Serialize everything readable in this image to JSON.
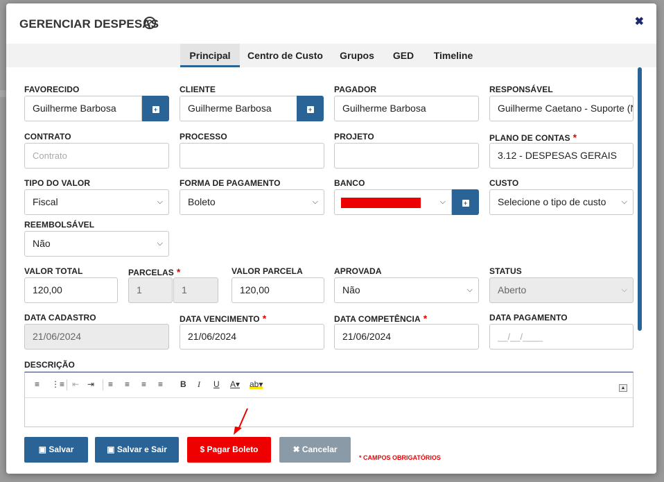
{
  "modal": {
    "title": "GERENCIAR DESPESAS",
    "help_glyph": "?",
    "close_glyph": "✖"
  },
  "tabs": [
    {
      "label": "Principal",
      "active": true
    },
    {
      "label": "Centro de Custo",
      "active": false
    },
    {
      "label": "Grupos",
      "active": false
    },
    {
      "label": "GED",
      "active": false
    },
    {
      "label": "Timeline",
      "active": false
    }
  ],
  "fields": {
    "favorecido": {
      "label": "FAVORECIDO",
      "value": "Guilherme Barbosa"
    },
    "cliente": {
      "label": "CLIENTE",
      "value": "Guilherme Barbosa"
    },
    "pagador": {
      "label": "PAGADOR",
      "value": "Guilherme Barbosa"
    },
    "responsavel": {
      "label": "RESPONSÁVEL",
      "value": "Guilherme Caetano - Suporte (N"
    },
    "contrato": {
      "label": "CONTRATO",
      "placeholder": "Contrato"
    },
    "processo": {
      "label": "PROCESSO",
      "value": ""
    },
    "projeto": {
      "label": "PROJETO",
      "value": ""
    },
    "plano_contas": {
      "label": "PLANO DE CONTAS",
      "value": "3.12 - DESPESAS GERAIS",
      "required": "*"
    },
    "tipo_valor": {
      "label": "TIPO DO VALOR",
      "value": "Fiscal"
    },
    "forma_pagamento": {
      "label": "FORMA DE PAGAMENTO",
      "value": "Boleto"
    },
    "banco": {
      "label": "BANCO",
      "value": ""
    },
    "custo": {
      "label": "CUSTO",
      "value": "Selecione o tipo de custo"
    },
    "reembolsavel": {
      "label": "REEMBOLSÁVEL",
      "value": "Não"
    },
    "valor_total": {
      "label": "VALOR TOTAL",
      "value": "120,00"
    },
    "parcelas": {
      "label": "PARCELAS",
      "value1": "1",
      "value2": "1",
      "required": "*"
    },
    "valor_parcela": {
      "label": "VALOR PARCELA",
      "value": "120,00"
    },
    "aprovada": {
      "label": "APROVADA",
      "value": "Não"
    },
    "status": {
      "label": "STATUS",
      "value": "Aberto"
    },
    "data_cadastro": {
      "label": "DATA CADASTRO",
      "value": "21/06/2024"
    },
    "data_vencimento": {
      "label": "DATA VENCIMENTO",
      "value": "21/06/2024",
      "required": "*"
    },
    "data_competencia": {
      "label": "DATA COMPETÊNCIA",
      "value": "21/06/2024",
      "required": "*"
    },
    "data_pagamento": {
      "label": "DATA PAGAMENTO",
      "placeholder": "__/__/____"
    },
    "descricao": {
      "label": "DESCRIÇÃO"
    }
  },
  "buttons": {
    "salvar": "Salvar",
    "salvar_sair": "Salvar e Sair",
    "pagar_boleto": "Pagar Boleto",
    "cancelar": "Cancelar"
  },
  "required_note": "* CAMPOS OBRIGATÓRIOS",
  "colors": {
    "primary": "#2a6496",
    "danger": "#ee0000",
    "muted": "#8a9aa6"
  }
}
